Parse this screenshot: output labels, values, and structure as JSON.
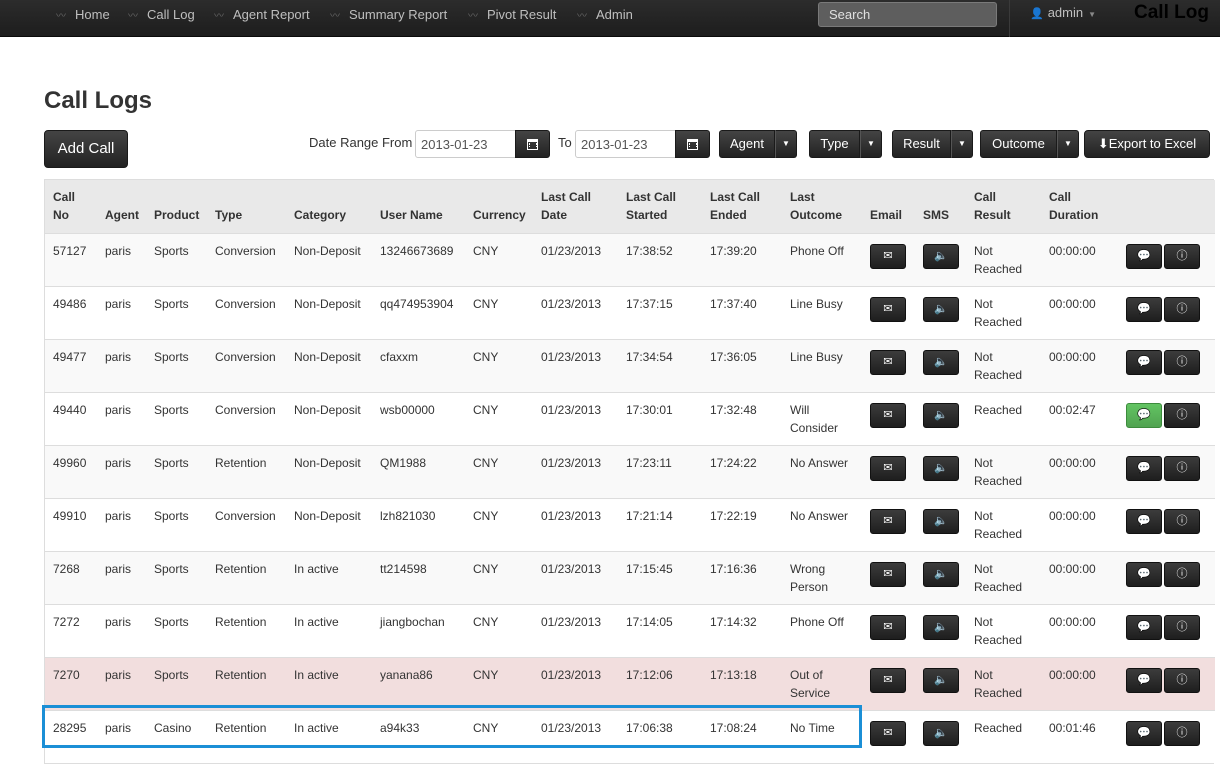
{
  "nav": {
    "items": [
      "Home",
      "Call Log",
      "Agent Report",
      "Summary Report",
      "Pivot Result",
      "Admin"
    ],
    "search_placeholder": "Search",
    "user": "admin",
    "brand": "Call Log"
  },
  "page": {
    "title": "Call Logs",
    "add_call": "Add Call",
    "date_from_label": "Date Range From",
    "date_from": "2013-01-23",
    "to_label": "To",
    "date_to": "2013-01-23",
    "filters": [
      "Agent",
      "Type",
      "Result",
      "Outcome"
    ],
    "export": "Export to Excel"
  },
  "table": {
    "headers": [
      "Call No",
      "Agent",
      "Product",
      "Type",
      "Category",
      "User Name",
      "Currency",
      "Last Call Date",
      "Last Call Started",
      "Last Call Ended",
      "Last Outcome",
      "Email",
      "SMS",
      "Call Result",
      "Call Duration",
      ""
    ],
    "rows": [
      {
        "call_no": "57127",
        "agent": "paris",
        "product": "Sports",
        "type": "Conversion",
        "category": "Non-Deposit",
        "user": "13246673689",
        "currency": "CNY",
        "date": "01/23/2013",
        "started": "17:38:52",
        "ended": "17:39:20",
        "outcome": "Phone Off",
        "result": "Not Reached",
        "duration": "00:00:00"
      },
      {
        "call_no": "49486",
        "agent": "paris",
        "product": "Sports",
        "type": "Conversion",
        "category": "Non-Deposit",
        "user": "qq474953904",
        "currency": "CNY",
        "date": "01/23/2013",
        "started": "17:37:15",
        "ended": "17:37:40",
        "outcome": "Line Busy",
        "result": "Not Reached",
        "duration": "00:00:00"
      },
      {
        "call_no": "49477",
        "agent": "paris",
        "product": "Sports",
        "type": "Conversion",
        "category": "Non-Deposit",
        "user": "cfaxxm",
        "currency": "CNY",
        "date": "01/23/2013",
        "started": "17:34:54",
        "ended": "17:36:05",
        "outcome": "Line Busy",
        "result": "Not Reached",
        "duration": "00:00:00"
      },
      {
        "call_no": "49440",
        "agent": "paris",
        "product": "Sports",
        "type": "Conversion",
        "category": "Non-Deposit",
        "user": "wsb00000",
        "currency": "CNY",
        "date": "01/23/2013",
        "started": "17:30:01",
        "ended": "17:32:48",
        "outcome": "Will Consider",
        "result": "Reached",
        "duration": "00:02:47",
        "comment_active": true
      },
      {
        "call_no": "49960",
        "agent": "paris",
        "product": "Sports",
        "type": "Retention",
        "category": "Non-Deposit",
        "user": "QM1988",
        "currency": "CNY",
        "date": "01/23/2013",
        "started": "17:23:11",
        "ended": "17:24:22",
        "outcome": "No Answer",
        "result": "Not Reached",
        "duration": "00:00:00"
      },
      {
        "call_no": "49910",
        "agent": "paris",
        "product": "Sports",
        "type": "Conversion",
        "category": "Non-Deposit",
        "user": "lzh821030",
        "currency": "CNY",
        "date": "01/23/2013",
        "started": "17:21:14",
        "ended": "17:22:19",
        "outcome": "No Answer",
        "result": "Not Reached",
        "duration": "00:00:00"
      },
      {
        "call_no": "7268",
        "agent": "paris",
        "product": "Sports",
        "type": "Retention",
        "category": "In active",
        "user": "tt214598",
        "currency": "CNY",
        "date": "01/23/2013",
        "started": "17:15:45",
        "ended": "17:16:36",
        "outcome": "Wrong Person",
        "result": "Not Reached",
        "duration": "00:00:00"
      },
      {
        "call_no": "7272",
        "agent": "paris",
        "product": "Sports",
        "type": "Retention",
        "category": "In active",
        "user": "jiangbochan",
        "currency": "CNY",
        "date": "01/23/2013",
        "started": "17:14:05",
        "ended": "17:14:32",
        "outcome": "Phone Off",
        "result": "Not Reached",
        "duration": "00:00:00"
      },
      {
        "call_no": "7270",
        "agent": "paris",
        "product": "Sports",
        "type": "Retention",
        "category": "In active",
        "user": "yanana86",
        "currency": "CNY",
        "date": "01/23/2013",
        "started": "17:12:06",
        "ended": "17:13:18",
        "outcome": "Out of Service",
        "result": "Not Reached",
        "duration": "00:00:00",
        "error": true
      },
      {
        "call_no": "28295",
        "agent": "paris",
        "product": "Casino",
        "type": "Retention",
        "category": "In active",
        "user": "a94k33",
        "currency": "CNY",
        "date": "01/23/2013",
        "started": "17:06:38",
        "ended": "17:08:24",
        "outcome": "No Time",
        "result": "Reached",
        "duration": "00:01:46"
      }
    ]
  },
  "icons": {
    "nav": "chart-icon",
    "user": "user-icon",
    "calendar": "calendar-icon",
    "email": "envelope-icon",
    "sms": "speaker-icon",
    "comment": "comment-icon",
    "info": "info-icon",
    "download": "download-icon"
  },
  "colors": {
    "navbar": "#1f1f1f",
    "button_dark": "#333333",
    "button_green": "#5bb75b",
    "row_error": "#f2dede",
    "highlight": "#1b8fd6"
  }
}
